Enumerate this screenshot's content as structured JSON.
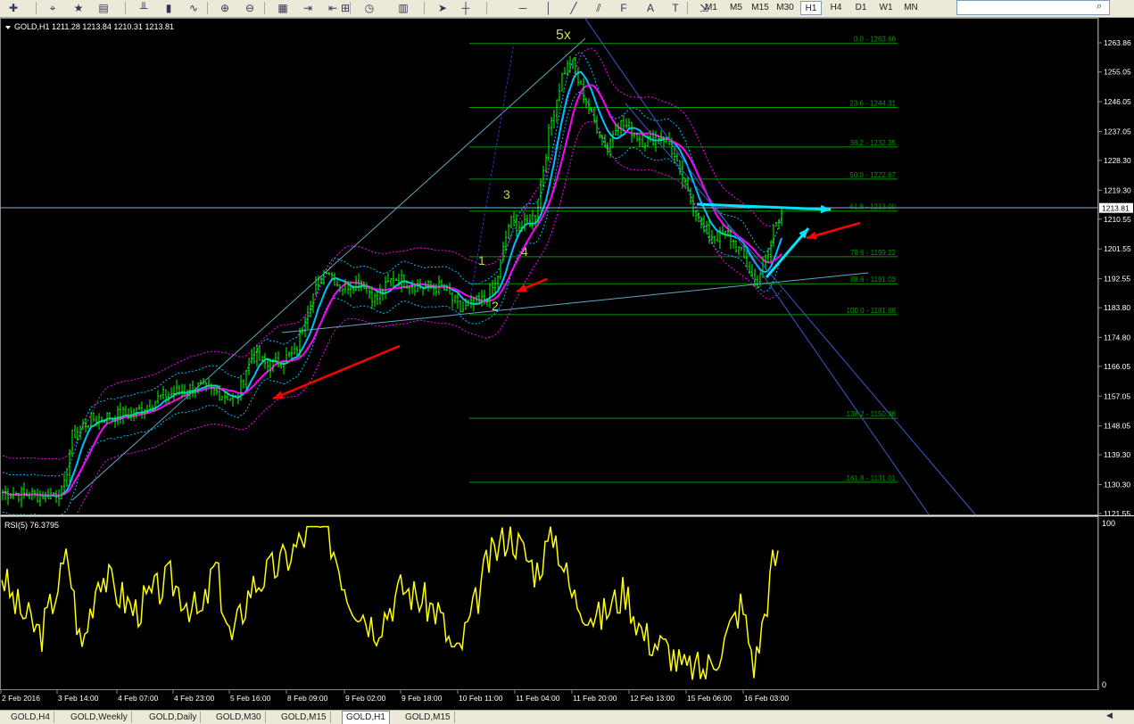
{
  "toolbar": {
    "icons": [
      "new-order-icon",
      "crosshair-icon",
      "favorites-icon",
      "book-icon",
      "bar-chart-icon",
      "candle-chart-icon",
      "line-chart-icon",
      "zoom-in-icon",
      "zoom-out-icon",
      "tile-icon",
      "autoscroll-icon",
      "shift-icon",
      "indicators-icon",
      "clock-icon",
      "template-icon",
      "cursor-icon",
      "cross-icon",
      "hline-icon",
      "vline-icon",
      "trendline-icon",
      "channel-icon",
      "fibo-icon",
      "text-icon",
      "label-icon",
      "arrow-icon"
    ],
    "timeframes": [
      "M1",
      "M5",
      "M15",
      "M30",
      "H1",
      "H4",
      "D1",
      "W1",
      "MN"
    ],
    "active_timeframe": "H1"
  },
  "chart": {
    "header": "GOLD,H1  1211.28 1213.84 1210.31 1213.81",
    "current_price": "1213.81",
    "price_labels": [
      "1263.86",
      "1255.05",
      "1246.05",
      "1237.05",
      "1228.30",
      "1219.30",
      "1210.55",
      "1201.55",
      "1192.55",
      "1183.80",
      "1174.80",
      "1166.05",
      "1157.05",
      "1148.05",
      "1139.30",
      "1130.30",
      "1121.55"
    ],
    "fib_levels": [
      "0.0 - 1263.66",
      "23.6 - 1244.31",
      "38.2 - 1232.35",
      "50.0 - 1222.67",
      "61.8 - 1213.00",
      "78.6 - 1199.22",
      "88.6 - 1191.03",
      "100.0 - 1181.68",
      "138.2 - 1150.36",
      "161.8 - 1131.01"
    ],
    "wave_labels": [
      "5x",
      "3",
      "4",
      "1",
      "2"
    ],
    "colors": {
      "background": "#000000",
      "candles": "#00ff00",
      "ma_fast": "#00bfff",
      "ma_slow": "#ff00ff",
      "fib": "#009900",
      "arrows_red": "#ff0000",
      "arrows_cyan": "#00e5ff",
      "rsi": "#ffff00"
    }
  },
  "rsi": {
    "label": "RSI(5) 76.3795",
    "scale_top": "100",
    "scale_bottom": "0"
  },
  "time_axis": [
    "2 Feb 2016",
    "3 Feb 14:00",
    "4 Feb 07:00",
    "4 Feb 23:00",
    "5 Feb 16:00",
    "8 Feb 09:00",
    "9 Feb 02:00",
    "9 Feb 18:00",
    "10 Feb 11:00",
    "11 Feb 04:00",
    "11 Feb 20:00",
    "12 Feb 13:00",
    "15 Feb 06:00",
    "16 Feb 03:00"
  ],
  "tabs": [
    "GOLD,H4",
    "GOLD,Weekly",
    "GOLD,Daily",
    "GOLD,M30",
    "GOLD,M15",
    "GOLD,H1",
    "GOLD,M15"
  ],
  "active_tab": "GOLD,H1"
}
